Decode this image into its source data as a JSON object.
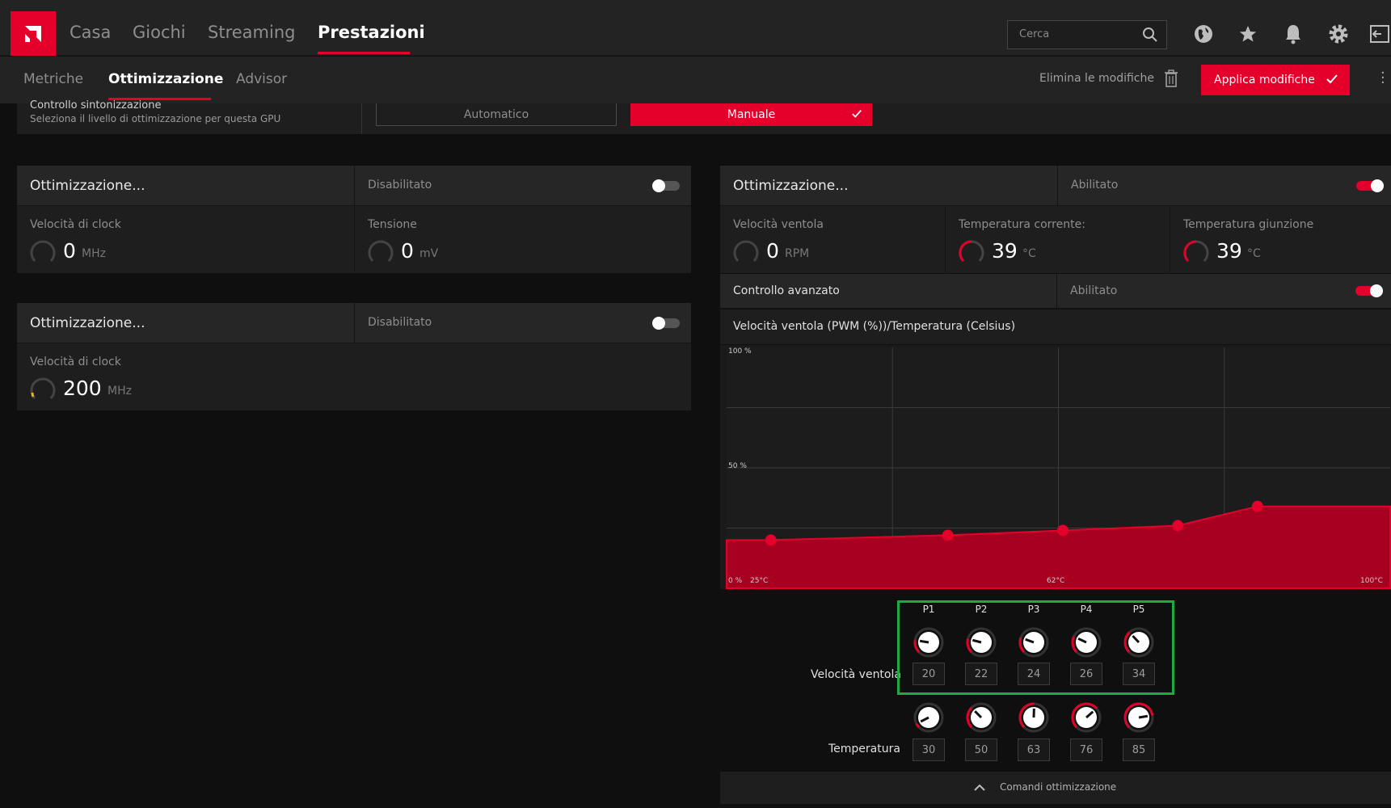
{
  "nav": {
    "items": [
      "Casa",
      "Giochi",
      "Streaming",
      "Prestazioni"
    ],
    "active": "Prestazioni",
    "search_placeholder": "Cerca"
  },
  "subnav": {
    "items": [
      "Metriche",
      "Ottimizzazione",
      "Advisor"
    ],
    "active": "Ottimizzazione",
    "discard_label": "Elimina le modifiche",
    "apply_label": "Applica modifiche"
  },
  "tuning_control": {
    "title": "Controllo sintonizzazione",
    "subtitle": "Seleziona il livello di ottimizzazione per questa GPU",
    "auto_label": "Automatico",
    "manual_label": "Manuale"
  },
  "panel_gpu": {
    "title": "Ottimizzazione...",
    "status": "Disabilitato",
    "clock": {
      "label": "Velocità di clock",
      "value": "0",
      "unit": "MHz"
    },
    "voltage": {
      "label": "Tensione",
      "value": "0",
      "unit": "mV"
    }
  },
  "panel_mem": {
    "title": "Ottimizzazione...",
    "status": "Disabilitato",
    "clock": {
      "label": "Velocità di clock",
      "value": "200",
      "unit": "MHz"
    }
  },
  "panel_fan": {
    "title": "Ottimizzazione...",
    "status": "Abilitato",
    "fan_speed": {
      "label": "Velocità ventola",
      "value": "0",
      "unit": "RPM"
    },
    "temp_current": {
      "label": "Temperatura corrente:",
      "value": "39",
      "unit": "°C"
    },
    "temp_junction": {
      "label": "Temperatura giunzione",
      "value": "39",
      "unit": "°C"
    },
    "advanced": {
      "label": "Controllo avanzato",
      "status": "Abilitato"
    },
    "curve_title": "Velocità ventola (PWM (%))/Temperatura (Celsius)"
  },
  "chart_data": {
    "type": "area",
    "title": "Velocità ventola (PWM (%))/Temperatura (Celsius)",
    "x": [
      30,
      50,
      63,
      76,
      85
    ],
    "values": [
      20,
      22,
      24,
      26,
      34
    ],
    "xlim": [
      25,
      100
    ],
    "ylim": [
      0,
      100
    ],
    "y_ticks": [
      "100 %",
      "50 %",
      "0 %"
    ],
    "x_ticks": [
      "25°C",
      "62°C",
      "100°C"
    ],
    "grid": true
  },
  "fan_points": {
    "labels": [
      "P1",
      "P2",
      "P3",
      "P4",
      "P5"
    ],
    "speed_label": "Velocità ventola",
    "temp_label": "Temperatura",
    "speeds": [
      "20",
      "22",
      "24",
      "26",
      "34"
    ],
    "temps": [
      "30",
      "50",
      "63",
      "76",
      "85"
    ]
  },
  "footer": {
    "label": "Comandi ottimizzazione"
  },
  "colors": {
    "accent": "#e4002b",
    "highlight": "#1fa846"
  }
}
